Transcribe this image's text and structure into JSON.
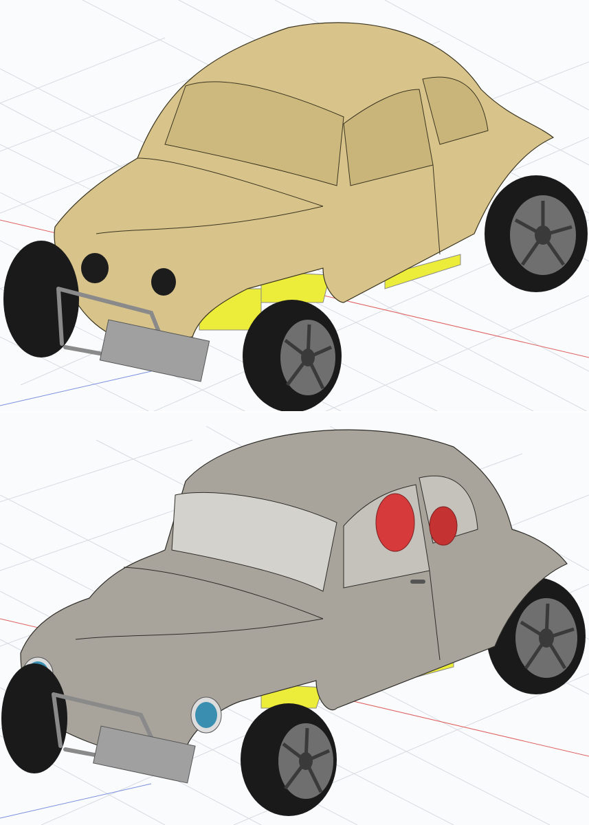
{
  "viewport": {
    "panels": [
      {
        "name": "cad-view-clay-body",
        "body_color": "#d8c48a",
        "body_shade": "#b8a468"
      },
      {
        "name": "cad-view-metallic-body",
        "body_color": "#a8a49c",
        "body_shade": "#7e7a72"
      }
    ]
  },
  "colors": {
    "grid_line": "#d6dbe2",
    "axis_red": "#e06060",
    "axis_blue": "#7a8fe0",
    "chassis_yellow": "#ecec3a",
    "tire": "#1a1a1a",
    "rim": "#6f6f6f",
    "headlight_lens": "#3a8fb0",
    "motor_red": "#d63a3a",
    "bumper": "#b0b0b0"
  },
  "icons": [
    "grid-plane",
    "buggy-model",
    "wheel",
    "headlight",
    "bumper-bar",
    "motor"
  ]
}
